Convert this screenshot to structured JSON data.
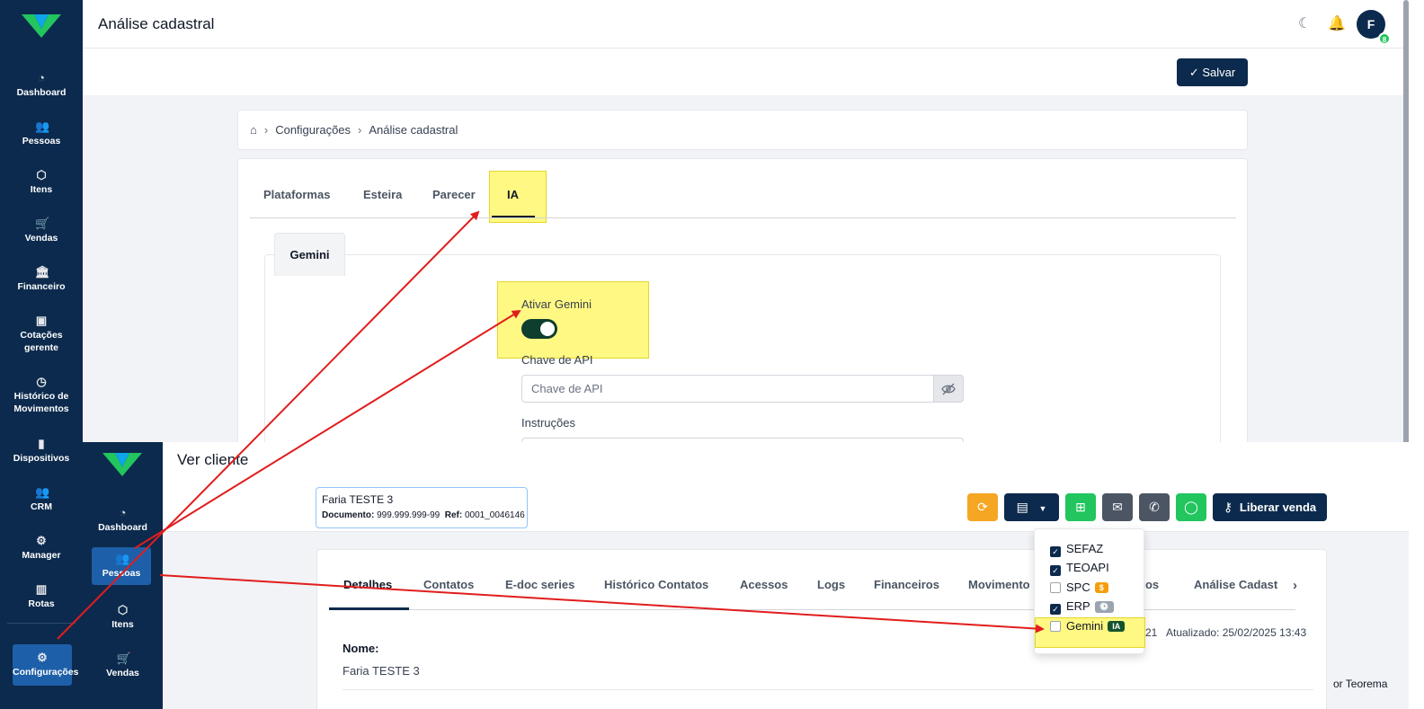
{
  "back": {
    "page_title": "Análise cadastral",
    "avatar_letter": "F",
    "avatar_badge": "8",
    "save_button": "Salvar",
    "breadcrumb": [
      "Configurações",
      "Análise cadastral"
    ],
    "sidebar": [
      {
        "label": "Dashboard",
        "icon": "gauge-icon"
      },
      {
        "label": "Pessoas",
        "icon": "users-icon"
      },
      {
        "label": "Itens",
        "icon": "box-icon"
      },
      {
        "label": "Vendas",
        "icon": "cart-icon"
      },
      {
        "label": "Financeiro",
        "icon": "bank-icon"
      },
      {
        "label": "Cotações gerente",
        "icon": "chart-icon"
      },
      {
        "label": "Histórico de Movimentos",
        "icon": "clock-icon"
      },
      {
        "label": "Dispositivos",
        "icon": "phone-icon"
      },
      {
        "label": "CRM",
        "icon": "users-icon"
      },
      {
        "label": "Manager",
        "icon": "gear-icon"
      },
      {
        "label": "Rotas",
        "icon": "map-icon"
      },
      {
        "label": "Configurações",
        "icon": "gear-icon"
      }
    ],
    "tabs": [
      "Plataformas",
      "Esteira",
      "Parecer",
      "IA"
    ],
    "subtab": "Gemini",
    "form": {
      "toggle_label": "Ativar Gemini",
      "toggle_on": true,
      "api_label": "Chave de API",
      "api_placeholder": "Chave de API",
      "instructions_label": "Instruções"
    }
  },
  "front": {
    "page_title": "Ver cliente",
    "sidebar": [
      {
        "label": "Dashboard",
        "icon": "gauge-icon"
      },
      {
        "label": "Pessoas",
        "icon": "users-icon"
      },
      {
        "label": "Itens",
        "icon": "box-icon"
      },
      {
        "label": "Vendas",
        "icon": "cart-icon"
      }
    ],
    "client": {
      "name": "Faria TESTE 3",
      "doc_label": "Documento:",
      "doc_value": "999.999.999-99",
      "ref_label": "Ref:",
      "ref_value": "0001_0046146"
    },
    "release_button": "Liberar venda",
    "tabs": [
      "Detalhes",
      "Contatos",
      "E-doc series",
      "Histórico Contatos",
      "Acessos",
      "Logs",
      "Financeiros",
      "Movimento",
      "dos",
      "Análise Cadast"
    ],
    "meta": {
      "created_tail": "21",
      "updated": "Atualizado: 25/02/2025 13:43"
    },
    "field": {
      "label": "Nome:",
      "value": "Faria TESTE 3"
    },
    "dropdown": [
      {
        "label": "SEFAZ",
        "checked": true,
        "badge": ""
      },
      {
        "label": "TEOAPI",
        "checked": true,
        "badge": ""
      },
      {
        "label": "SPC",
        "checked": false,
        "badge": "$",
        "badge_color": "#f59e0b"
      },
      {
        "label": "ERP",
        "checked": true,
        "badge": "🕒",
        "badge_color": "#9ca3af"
      },
      {
        "label": "Gemini",
        "checked": false,
        "badge": "IA",
        "badge_color": "#14532d"
      }
    ],
    "footer": "or Teorema"
  },
  "colors": {
    "sidebar": "#0c2a4d",
    "highlight": "#fff55a",
    "arrow": "#e11d1d",
    "refresh": "#f5a623",
    "green": "#22c55e",
    "grey": "#4b5563",
    "whatsapp": "#22c55e"
  }
}
